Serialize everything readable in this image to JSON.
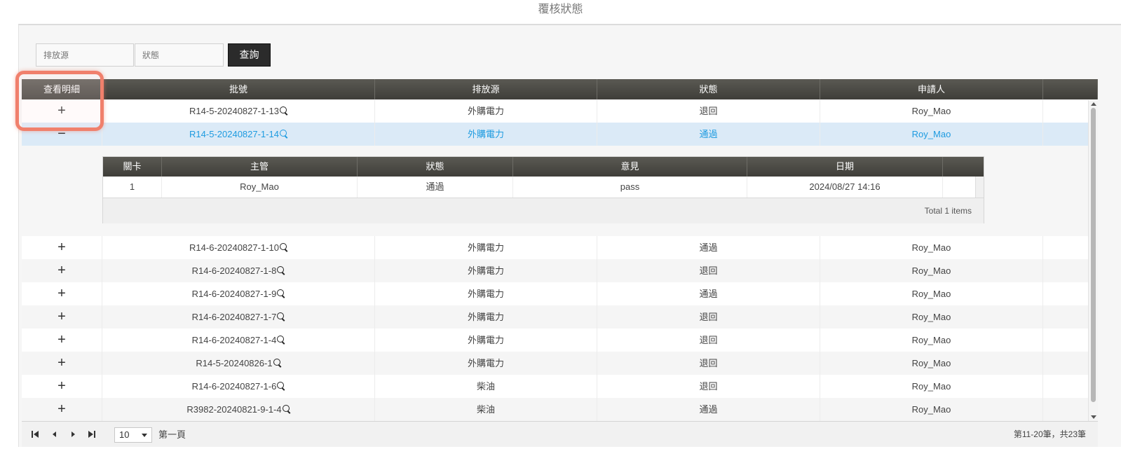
{
  "page": {
    "title": "覆核狀態"
  },
  "search": {
    "source_placeholder": "排放源",
    "status_placeholder": "狀態",
    "button_label": "查詢"
  },
  "grid": {
    "columns": [
      "查看明細",
      "批號",
      "排放源",
      "狀態",
      "申請人"
    ],
    "rows": [
      {
        "expander": "+",
        "batch": "R14-5-20240827-1-13",
        "source": "外購電力",
        "status": "退回",
        "applicant": "Roy_Mao"
      },
      {
        "expander": "−",
        "batch": "R14-5-20240827-1-14",
        "source": "外購電力",
        "status": "通過",
        "applicant": "Roy_Mao"
      },
      {
        "expander": "+",
        "batch": "R14-6-20240827-1-10",
        "source": "外購電力",
        "status": "通過",
        "applicant": "Roy_Mao"
      },
      {
        "expander": "+",
        "batch": "R14-6-20240827-1-8",
        "source": "外購電力",
        "status": "退回",
        "applicant": "Roy_Mao"
      },
      {
        "expander": "+",
        "batch": "R14-6-20240827-1-9",
        "source": "外購電力",
        "status": "通過",
        "applicant": "Roy_Mao"
      },
      {
        "expander": "+",
        "batch": "R14-6-20240827-1-7",
        "source": "外購電力",
        "status": "退回",
        "applicant": "Roy_Mao"
      },
      {
        "expander": "+",
        "batch": "R14-6-20240827-1-4",
        "source": "外購電力",
        "status": "退回",
        "applicant": "Roy_Mao"
      },
      {
        "expander": "+",
        "batch": "R14-5-20240826-1",
        "source": "外購電力",
        "status": "退回",
        "applicant": "Roy_Mao"
      },
      {
        "expander": "+",
        "batch": "R14-6-20240827-1-6",
        "source": "柴油",
        "status": "退回",
        "applicant": "Roy_Mao"
      },
      {
        "expander": "+",
        "batch": "R3982-20240821-9-1-4",
        "source": "柴油",
        "status": "通過",
        "applicant": "Roy_Mao"
      }
    ],
    "detail": {
      "columns": [
        "關卡",
        "主管",
        "狀態",
        "意見",
        "日期"
      ],
      "rows": [
        {
          "stage": "1",
          "manager": "Roy_Mao",
          "status": "通過",
          "comment": "pass",
          "date": "2024/08/27 14:16"
        }
      ],
      "total": "Total 1 items"
    }
  },
  "pager": {
    "page_size": "10",
    "page_label": "第一頁",
    "range_text": "第11-20筆，共23筆"
  },
  "icons": {
    "first": "first-page-icon",
    "prev": "prev-page-icon",
    "next": "next-page-icon",
    "last": "last-page-icon",
    "search": "magnifier-icon"
  },
  "colors": {
    "header_bg": "#4c4b46",
    "selected_row_bg": "#dbeaf7",
    "selected_text": "#1e9be0",
    "highlight_border": "#f0806c"
  }
}
